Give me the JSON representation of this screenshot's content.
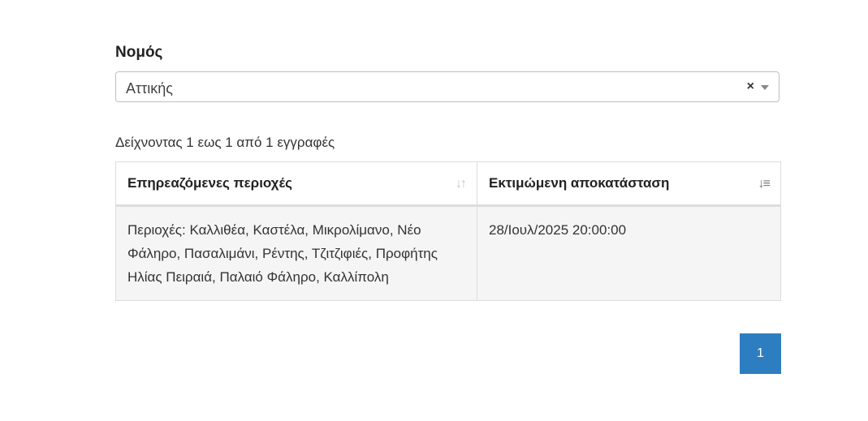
{
  "filter": {
    "label": "Νομός",
    "selected_value": "Αττικής",
    "clear_symbol": "×"
  },
  "info": {
    "text": "Δείχνοντας 1 εως 1 από 1 εγγραφές"
  },
  "table": {
    "headers": [
      "Επηρεαζόμενες περιοχές",
      "Εκτιμώμενη αποκατάσταση"
    ],
    "rows": [
      {
        "areas": "Περιοχές: Καλλιθέα, Καστέλα, Μικρολίμανο, Νέο Φάληρο, Πασαλιμάνι, Ρέντης, Τζιτζιφιές, Προφήτης Ηλίας Πειραιά, Παλαιό Φάληρο, Καλλίπολη",
        "restoration": "28/Ιουλ/2025 20:00:00"
      }
    ]
  },
  "pagination": {
    "current_page": "1"
  }
}
